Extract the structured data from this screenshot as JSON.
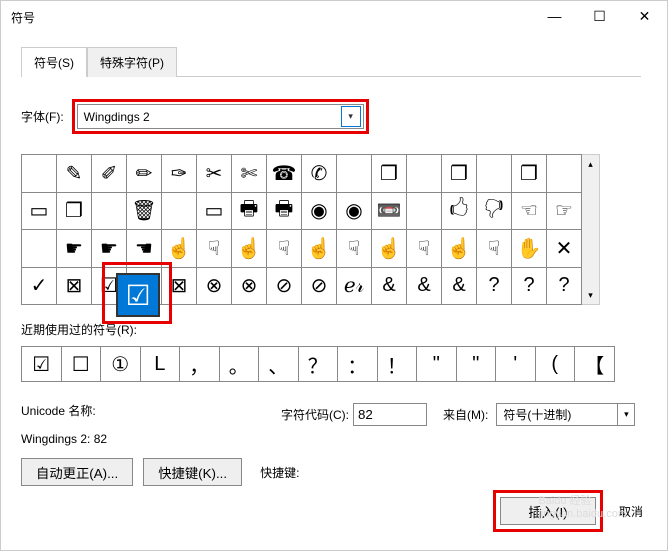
{
  "title": "符号",
  "tabs": {
    "symbols": "符号(S)",
    "special": "特殊字符(P)"
  },
  "fontLabel": "字体(F):",
  "fontValue": "Wingdings 2",
  "recentLabel": "近期使用过的符号(R):",
  "recent": [
    "☑",
    "☐",
    "①",
    "L",
    "，",
    "。",
    "、",
    "？",
    "：",
    "！",
    "\"",
    "\"",
    "'",
    "(",
    "【"
  ],
  "unicodeNameLabel": "Unicode 名称:",
  "unicodeName": "Wingdings 2: 82",
  "charCodeLabel": "字符代码(C):",
  "charCode": "82",
  "fromLabel": "来自(M):",
  "fromValue": "符号(十进制)",
  "autoCorrect": "自动更正(A)...",
  "shortcutBtn": "快捷键(K)...",
  "shortcutLabel": "快捷键:",
  "insert": "插入(I)",
  "cancel": "取消",
  "selectedSymbol": "☑",
  "grid": [
    [
      "",
      "✎",
      "✐",
      "✏",
      "✑",
      "✂",
      "✄",
      "☎",
      "✆",
      "",
      "❐",
      "",
      "❐",
      "",
      "❐",
      ""
    ],
    [
      "▭",
      "❐",
      "",
      "🗑",
      "",
      "▭",
      "🖶",
      "🖶",
      "◉",
      "◉",
      "📼",
      "",
      "🖒",
      "🖓",
      "☜",
      "☞"
    ],
    [
      "",
      "☛",
      "☛",
      "☚",
      "☝",
      "☟",
      "☝",
      "☟",
      "☝",
      "☟",
      "☝",
      "☟",
      "☝",
      "☟",
      "✋",
      "✕"
    ],
    [
      "✓",
      "⊠",
      "☑",
      "⊠",
      "⊠",
      "⊗",
      "⊗",
      "⊘",
      "⊘",
      "ℯ𝓇",
      "&",
      "&",
      "&",
      "?",
      "?",
      "?"
    ]
  ]
}
